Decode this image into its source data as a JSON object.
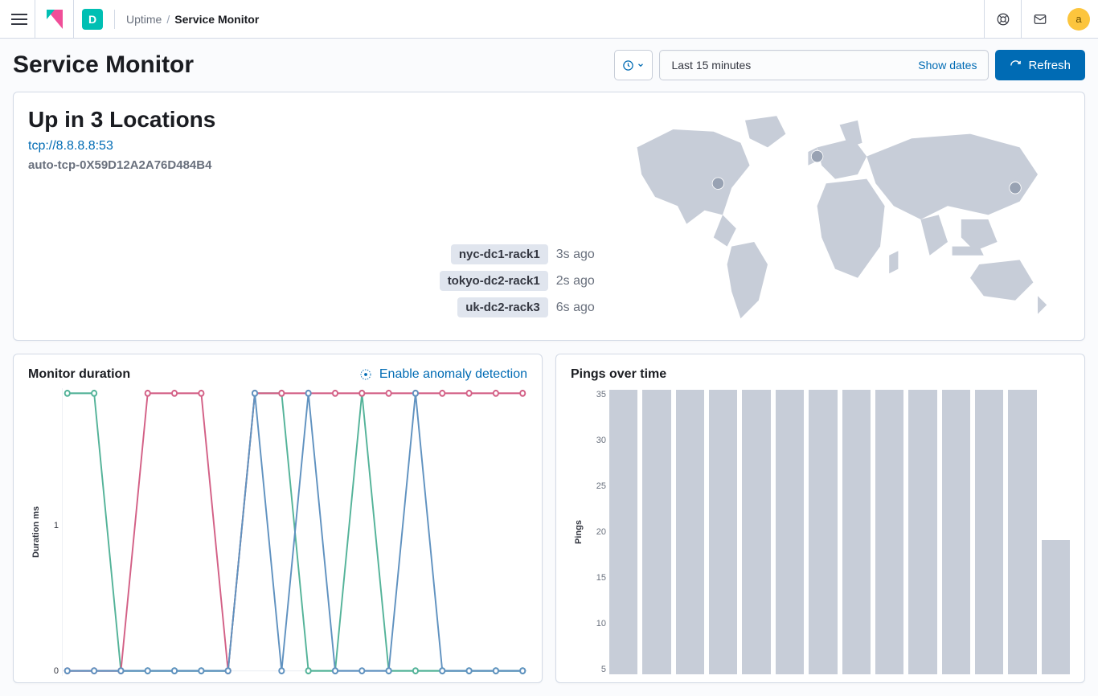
{
  "header": {
    "space_initial": "D",
    "avatar_initial": "a",
    "breadcrumbs": {
      "parent": "Uptime",
      "current": "Service Monitor"
    }
  },
  "title": "Service Monitor",
  "date_picker": {
    "range_label": "Last 15 minutes",
    "show_dates_label": "Show dates",
    "refresh_label": "Refresh"
  },
  "status_panel": {
    "headline": "Up in 3 Locations",
    "url": "tcp://8.8.8.8:53",
    "monitor_id": "auto-tcp-0X59D12A2A76D484B4",
    "locations": [
      {
        "name": "nyc-dc1-rack1",
        "age": "3s ago"
      },
      {
        "name": "tokyo-dc2-rack1",
        "age": "2s ago"
      },
      {
        "name": "uk-dc2-rack3",
        "age": "6s ago"
      }
    ]
  },
  "duration_panel": {
    "title": "Monitor duration",
    "anomaly_label": "Enable anomaly detection",
    "y_axis_label": "Duration ms",
    "y_ticks": [
      "1",
      "0"
    ]
  },
  "pings_panel": {
    "title": "Pings over time",
    "y_axis_label": "Pings",
    "y_ticks": [
      "35",
      "30",
      "25",
      "20",
      "15",
      "10",
      "5"
    ]
  },
  "chart_data": [
    {
      "type": "line",
      "title": "Monitor duration",
      "ylabel": "Duration ms",
      "ylim": [
        0,
        1.6
      ],
      "x": [
        0,
        1,
        2,
        3,
        4,
        5,
        6,
        7,
        8,
        9,
        10,
        11,
        12,
        13,
        14,
        15,
        16,
        17
      ],
      "series": [
        {
          "name": "nyc-dc1-rack1",
          "color": "#54b399",
          "values": [
            1.6,
            1.6,
            0,
            0,
            0,
            0,
            0,
            1.6,
            1.6,
            0,
            0,
            1.6,
            0,
            0,
            0,
            0,
            0,
            0
          ]
        },
        {
          "name": "tokyo-dc2-rack1",
          "color": "#d36086",
          "values": [
            0,
            0,
            0,
            1.6,
            1.6,
            1.6,
            0,
            1.6,
            1.6,
            1.6,
            1.6,
            1.6,
            1.6,
            1.6,
            1.6,
            1.6,
            1.6,
            1.6
          ]
        },
        {
          "name": "uk-dc2-rack3",
          "color": "#6092c0",
          "values": [
            0,
            0,
            0,
            0,
            0,
            0,
            0,
            1.6,
            0,
            1.6,
            0,
            0,
            0,
            1.6,
            0,
            0,
            0,
            0
          ]
        }
      ]
    },
    {
      "type": "bar",
      "title": "Pings over time",
      "ylabel": "Pings",
      "ylim": [
        0,
        36
      ],
      "categories": [
        0,
        1,
        2,
        3,
        4,
        5,
        6,
        7,
        8,
        9,
        10,
        11,
        12,
        13
      ],
      "values": [
        36,
        36,
        36,
        36,
        36,
        36,
        36,
        36,
        36,
        36,
        36,
        36,
        36,
        17
      ]
    }
  ]
}
